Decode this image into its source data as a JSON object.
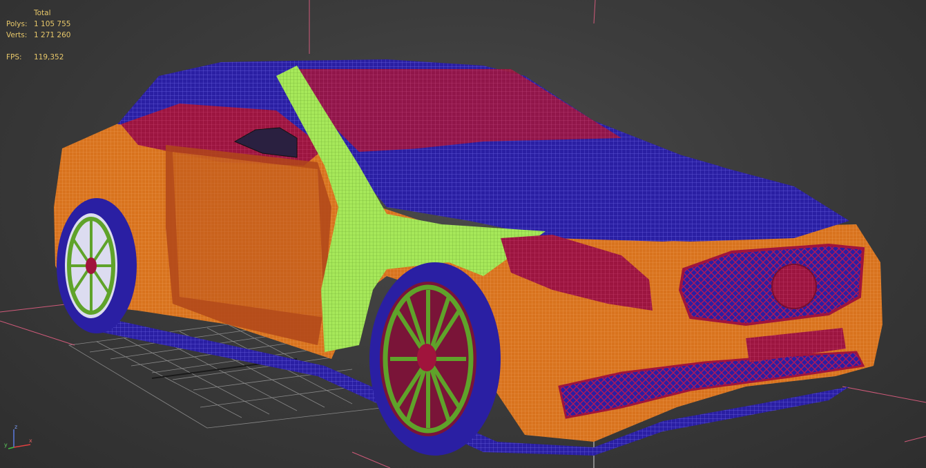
{
  "stats": {
    "header": "Total",
    "polys_label": "Polys:",
    "polys_value": "1 105 755",
    "verts_label": "Verts:",
    "verts_value": "1 271 260",
    "fps_label": "FPS:",
    "fps_value": "119,352"
  },
  "gizmo": {
    "z": "z",
    "x": "x",
    "y": "y"
  },
  "colors": {
    "background": "#3c3c3c",
    "stats_text": "#e8c86a",
    "body_orange": "#d8731e",
    "wire_blue": "#2a1fa3",
    "wire_red": "#a0143c",
    "wire_green": "#a6e85a",
    "wheel_green": "#5fa32a"
  },
  "scene": {
    "object": "car wireframe model",
    "view": "perspective"
  }
}
